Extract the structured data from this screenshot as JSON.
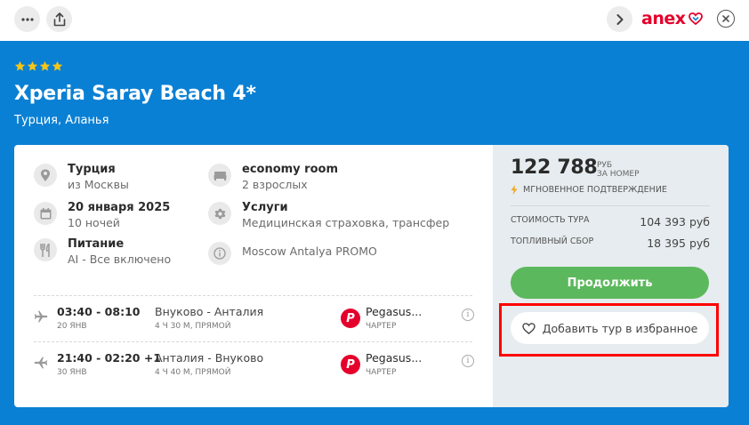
{
  "topbar": {
    "more_icon": "more-horizontal-icon",
    "share_icon": "share-icon",
    "next_icon": "chevron-right-icon",
    "logo_text": "anex",
    "close_icon": "close-icon"
  },
  "hotel": {
    "stars": 4,
    "name": "Xperia Saray Beach 4*",
    "location": "Турция, Аланья"
  },
  "details": [
    {
      "icon": "location-pin-icon",
      "title": "Турция",
      "subtitle": "из Москвы"
    },
    {
      "icon": "bed-icon",
      "title": "economy room",
      "subtitle": "2 взрослых"
    },
    {
      "icon": "calendar-icon",
      "title": "20 января 2025",
      "subtitle": "10 ночей"
    },
    {
      "icon": "gear-icon",
      "title": "Услуги",
      "subtitle": "Медицинская страховка, трансфер"
    },
    {
      "icon": "fork-knife-icon",
      "title": "Питание",
      "subtitle": "AI - Все включено"
    },
    {
      "icon": "info-icon",
      "title": "",
      "subtitle": "Moscow Antalya PROMO"
    }
  ],
  "flights": [
    {
      "time": "03:40 - 08:10",
      "date": "20 ЯНВ",
      "route": "Внуково - Анталия",
      "duration": "4 Ч 30 М, ПРЯМОЙ",
      "airline": "Pegasus...",
      "type": "ЧАРТЕР"
    },
    {
      "time": "21:40 - 02:20 +1",
      "date": "30 ЯНВ",
      "route": "Анталия - Внуково",
      "duration": "4 Ч 40 М, ПРЯМОЙ",
      "airline": "Pegasus...",
      "type": "ЧАРТЕР"
    }
  ],
  "airline_logo_letter": "P",
  "pricing": {
    "total": "122 788",
    "currency": "РУБ",
    "per": "ЗА НОМЕР",
    "instant": "МГНОВЕННОЕ ПОДТВЕРЖДЕНИЕ",
    "tour_cost_label": "СТОИМОСТЬ ТУРА",
    "tour_cost_value": "104 393 руб",
    "fuel_label": "ТОПЛИВНЫЙ СБОР",
    "fuel_value": "18 395 руб"
  },
  "actions": {
    "continue_label": "Продолжить",
    "favorite_label": "Добавить тур в избранное"
  },
  "colors": {
    "hero_bg": "#0a80d4",
    "star": "#f5c518",
    "continue_bg": "#5cb85c",
    "brand_red": "#e4002b",
    "highlight_box": "#ff0000"
  }
}
